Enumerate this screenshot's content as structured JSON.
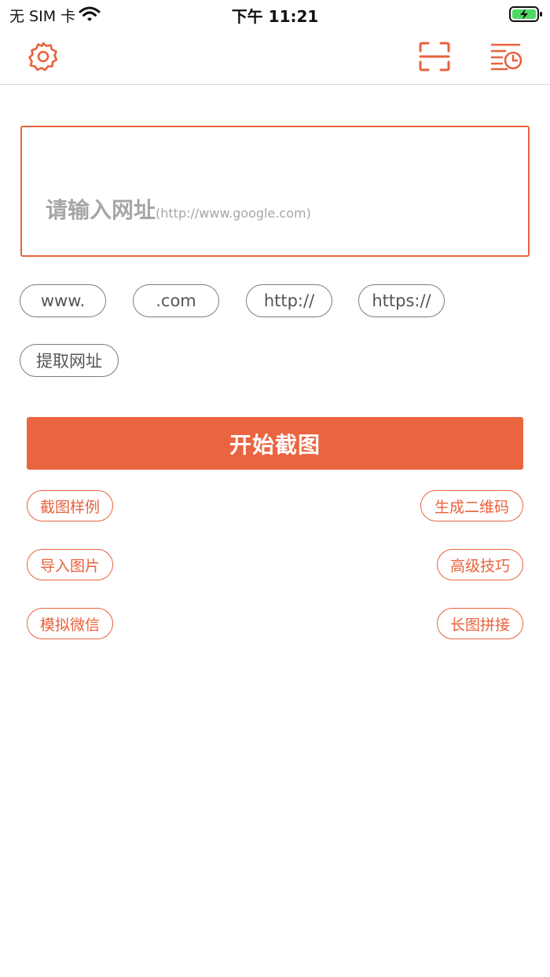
{
  "status_bar": {
    "carrier": "无 SIM 卡",
    "time": "下午 11:21",
    "wifi_icon": "wifi-icon",
    "battery_icon": "battery-charging-icon"
  },
  "toolbar": {
    "settings_icon": "gear-icon",
    "scan_icon": "scan-frame-icon",
    "history_icon": "history-list-icon",
    "accent_color": "#e8623d"
  },
  "url_input": {
    "placeholder_main": "请输入网址",
    "placeholder_hint": "(http://www.google.com)",
    "value": ""
  },
  "quick_insert": [
    {
      "label": "www."
    },
    {
      "label": ".com"
    },
    {
      "label": "http://"
    },
    {
      "label": "https://"
    }
  ],
  "extract_url_label": "提取网址",
  "start_button_label": "开始截图",
  "actions": {
    "sample": "截图样例",
    "qr": "生成二维码",
    "import_image": "导入图片",
    "advanced_tips": "高级技巧",
    "simulate_wechat": "模拟微信",
    "long_stitch": "长图拼接"
  },
  "colors": {
    "primary": "#ea6440",
    "border_gray": "#7d7d7d",
    "placeholder_gray": "#a6a6a6"
  }
}
